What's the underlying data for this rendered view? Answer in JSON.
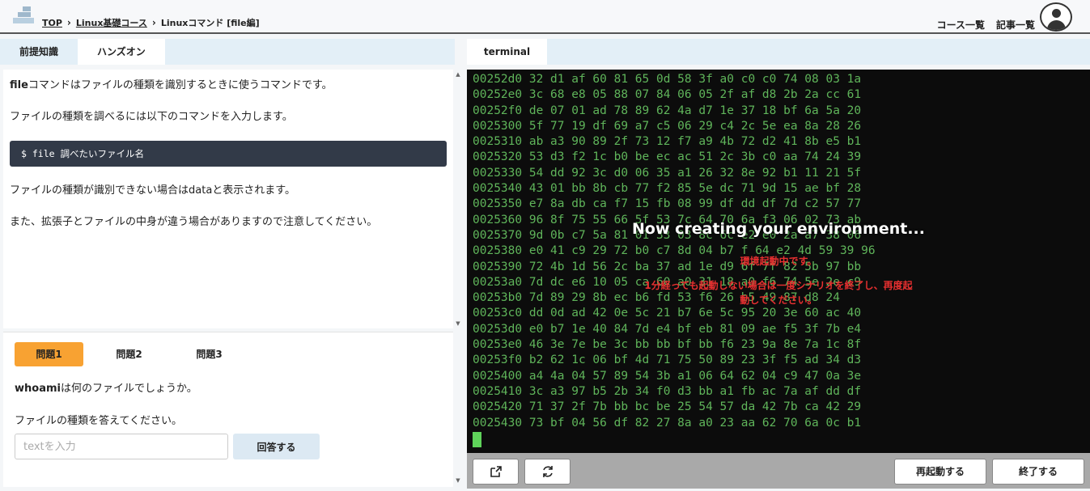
{
  "header": {
    "breadcrumb": [
      "TOP",
      "Linux基礎コース",
      "Linuxコマンド [file編]"
    ],
    "links": [
      "コース一覧",
      "記事一覧"
    ]
  },
  "left_tabs": [
    "前提知識",
    "ハンズオン"
  ],
  "content": {
    "p1_bold": "file",
    "p1_rest": "コマンドはファイルの種類を識別するときに使うコマンドです。",
    "p2": "ファイルの種類を調べるには以下のコマンドを入力します。",
    "code": "$ file 調べたいファイル名",
    "p3": "ファイルの種類が識別できない場合はdataと表示されます。",
    "p4": "また、拡張子とファイルの中身が違う場合がありますので注意してください。"
  },
  "questions": {
    "tabs": [
      "問題1",
      "問題2",
      "問題3"
    ],
    "q_bold": "whoami",
    "q_rest": "は何のファイルでしょうか。",
    "q2": "ファイルの種類を答えてください。",
    "placeholder": "textを入力",
    "submit": "回答する"
  },
  "terminal": {
    "tab": "terminal",
    "hex_lines": [
      "00252d0 32 d1 af 60 81 65 0d 58 3f a0 c0 c0 74 08 03 1a",
      "00252e0 3c 68 e8 05 88 07 84 06 05 2f af d8 2b 2a cc 61",
      "00252f0 de 07 01 ad 78 89 62 4a d7 1e 37 18 bf 6a 5a 20",
      "0025300 5f 77 19 df 69 a7 c5 06 29 c4 2c 5e ea 8a 28 26",
      "0025310 ab a3 90 89 2f 73 12 f7 a9 4b 72 d2 41 8b e5 b1",
      "0025320 53 d3 f2 1c b0 be ec ac 51 2c 3b c0 aa 74 24 39",
      "0025330 54 dd 92 3c d0 06 35 a1 26 32 8e 92 b1 11 21 5f",
      "0025340 43 01 bb 8b cb 77 f2 85 5e dc 71 9d 15 ae bf 28",
      "0025350 e7 8a db ca f7 15 fb 08 99 df dd df 7d c2 57 77",
      "0025360 96 8f 75 55 66 5f 53 7c 64 70 6a f3 06 02 73 ab",
      "0025370 9d 0b c7 5a 81 01 33 03 8c 6c e2 e0 2a a7 38 06",
      "0025380 e0 41 c9 29 72 b0 c7 8d 04 b7 f 64 e2 4d 59 39 96",
      "0025390 72 4b 1d 56 2c ba 37 ad 1e d9 6f 7f 82 5b 97 bb",
      "00253a0 7d dc e6 10 05 ca 60 a0 31 18 a0 f6 74 5e 2e c9",
      "00253b0 7d 89 29 8b ec b6 fd 53 f6 26 b5 49 87 d8 24",
      "00253c0 dd 0d ad 42 0e 5c 21 b7 6e 5c 95 20 3e 60 ac 40",
      "00253d0 e0 b7 1e 40 84 7d e4 bf eb 81 09 ae f5 3f 7b e4",
      "00253e0 46 3e 7e be 3c bb bb bf bb f6 23 9a 8e 7a 1c 8f",
      "00253f0 b2 62 1c 06 bf 4d 71 75 50 89 23 3f f5 ad 34 d3",
      "0025400 a4 4a 04 57 89 54 3b a1 06 64 62 04 c9 47 0a 3e",
      "0025410 3c a3 97 b5 2b 34 f0 d3 bb a1 fb ac 7a af dd df",
      "0025420 71 37 2f 7b bb bc be 25 54 57 da 42 7b ca 42 29",
      "0025430 73 bf 04 56 df 82 27 8a a0 23 aa 62 70 6a 0c b1"
    ],
    "overlay_title": "Now creating your environment...",
    "overlay_msgs": [
      "環境起動中です。",
      "1分経っても起動しない場合は一度シナリオを終了し、再度起",
      "動してください。"
    ],
    "buttons": {
      "open_external": "open-external-icon",
      "refresh": "refresh-icon",
      "restart": "再起動する",
      "finish": "終了する"
    }
  }
}
